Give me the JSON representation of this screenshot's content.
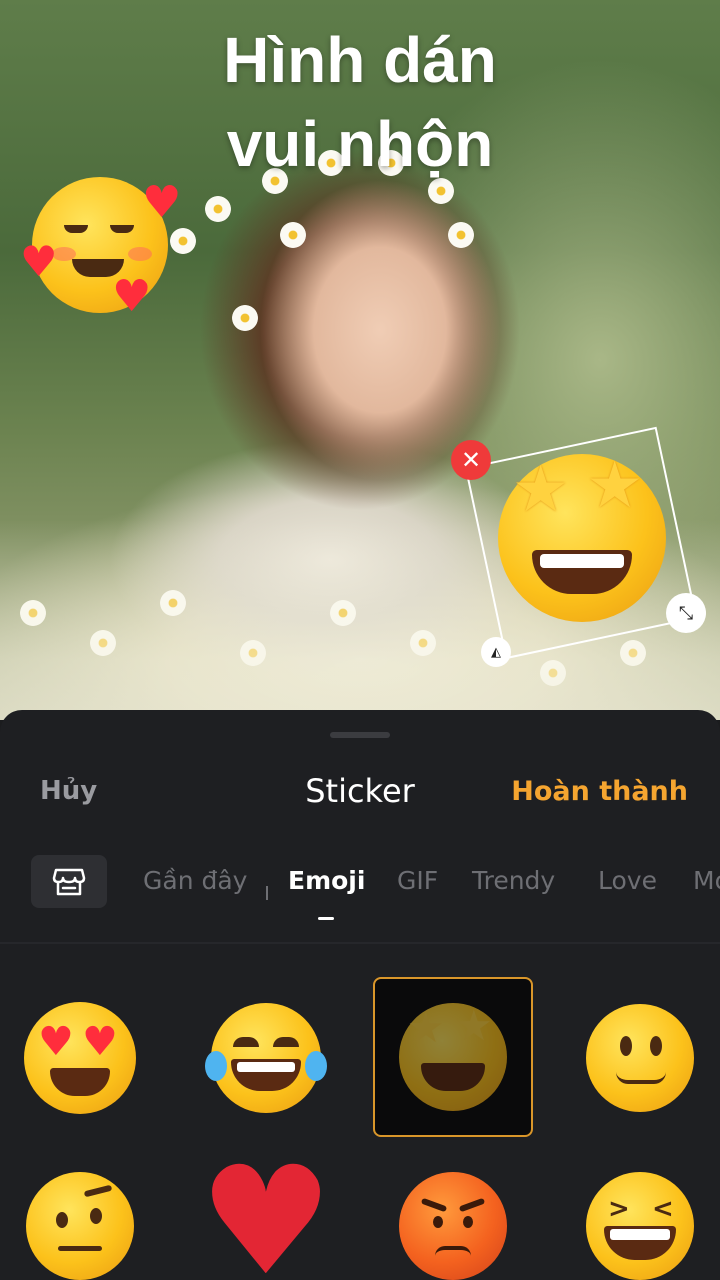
{
  "promo": {
    "line1": "Hình dán",
    "line2": "vui nhộn"
  },
  "canvas_stickers": {
    "left_sticker": "smiling-face-with-hearts",
    "selected_sticker": "star-struck"
  },
  "sheet": {
    "cancel_label": "Hủy",
    "title": "Sticker",
    "done_label": "Hoàn thành"
  },
  "tabs": {
    "items": [
      {
        "label": "Gần đây"
      },
      {
        "label": "Emoji"
      },
      {
        "label": "GIF"
      },
      {
        "label": "Trendy"
      },
      {
        "label": "Love"
      },
      {
        "label": "Mo"
      }
    ],
    "active": "Emoji"
  },
  "emoji_grid": [
    "heart-eyes-emoji",
    "tears-of-joy-emoji",
    "star-struck-emoji",
    "slightly-smiling-emoji",
    "raised-eyebrow-emoji",
    "red-heart-emoji",
    "angry-face-emoji",
    "squinting-grin-emoji"
  ],
  "colors": {
    "accent": "#f5a530",
    "sheet_bg": "#1e1f22",
    "delete_handle": "#ef3a3a"
  }
}
